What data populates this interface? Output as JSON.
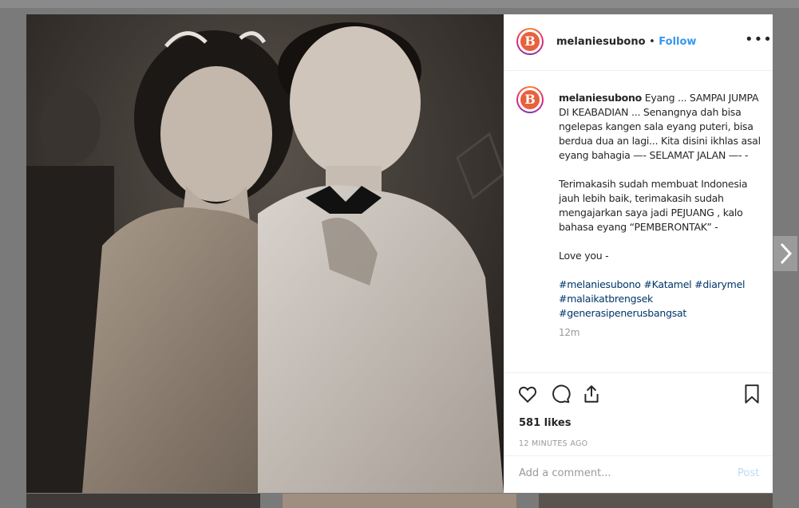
{
  "post": {
    "username": "melaniesubono",
    "separator": "•",
    "follow_label": "Follow",
    "more_label": "•••",
    "avatar_letter": "B"
  },
  "caption": {
    "username": "melaniesubono",
    "text": " Eyang ... SAMPAI JUMPA DI KEABADIAN ... Senangnya dah bisa ngelepas kangen sala eyang puteri, bisa berdua dua an lagi... Kita disini ikhlas asal eyang bahagia —- SELAMAT JALAN —- -\n\nTerimakasih sudah membuat Indonesia jauh lebih baik, terimakasih sudah mengajarkan saya jadi PEJUANG , kalo bahasa eyang “PEMBERONTAK” -\n\nLove you -\n\n",
    "hashtags_line1": "#melaniesubono #Katamel #diarymel",
    "hashtags_line2": "#malaikatbrengsek",
    "hashtags_line3": "#generasipenerusbangsat",
    "time": "12m"
  },
  "actions": {
    "icons": [
      "heart-icon",
      "comment-icon",
      "share-icon",
      "bookmark-icon"
    ],
    "likes": "581 likes",
    "posted": "12 MINUTES AGO"
  },
  "comment_box": {
    "placeholder": "Add a comment...",
    "post_label": "Post"
  },
  "colors": {
    "link": "#3897f0",
    "hashtag": "#003569",
    "text": "#262626",
    "muted": "#999999",
    "post_disabled": "#b9dcf9",
    "overlay": "#7a7a7a"
  }
}
